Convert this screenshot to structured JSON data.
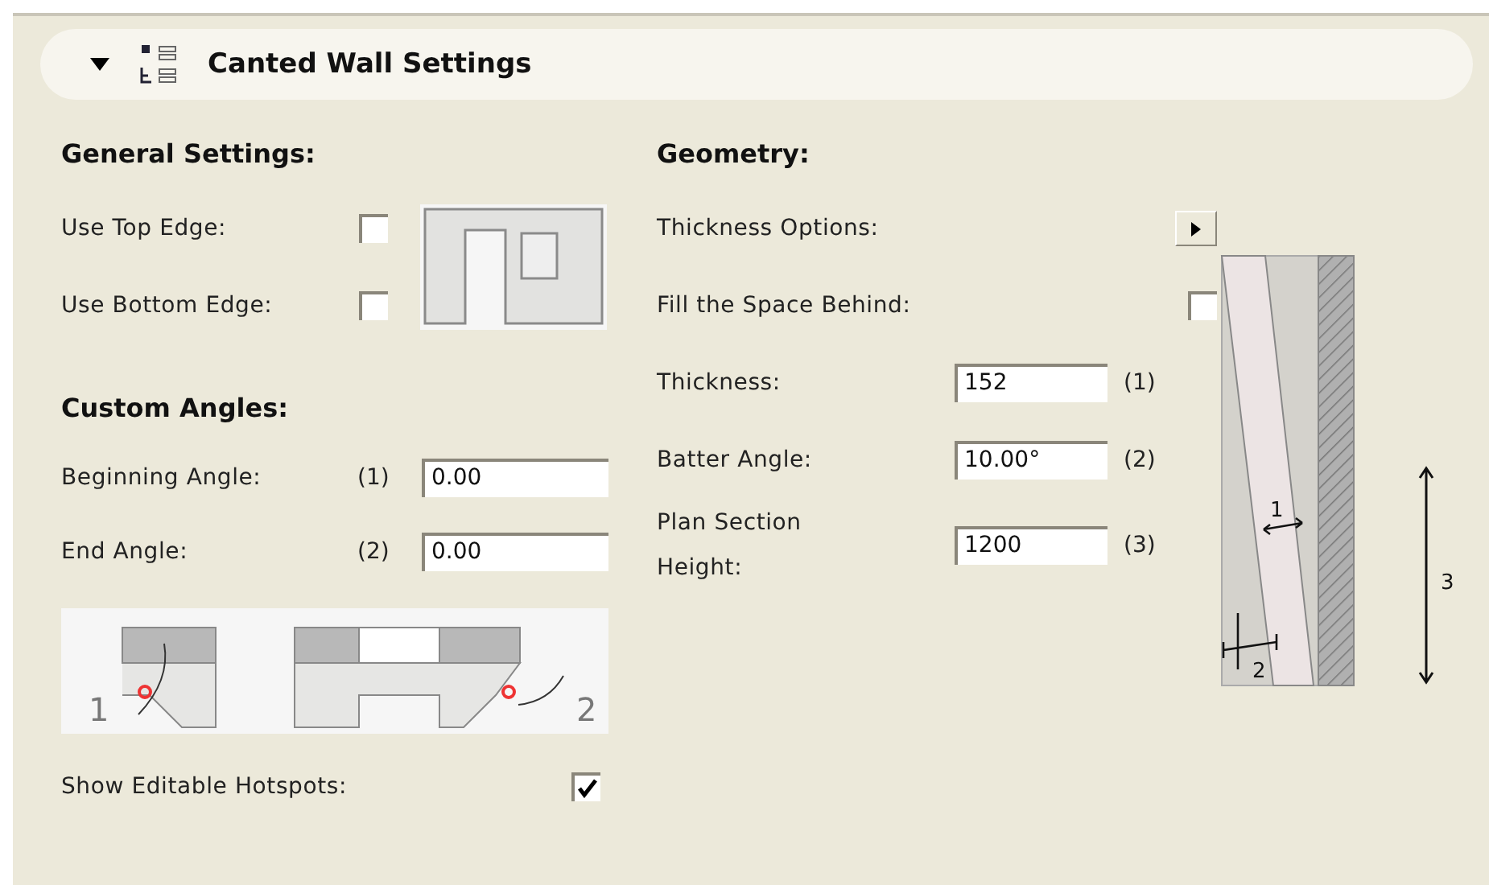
{
  "panel": {
    "title": "Canted Wall Settings",
    "expanded": true
  },
  "general": {
    "heading": "General Settings:",
    "checkboxes": [
      {
        "label": "Use Top Edge:",
        "checked": false
      },
      {
        "label": "Use Bottom Edge:",
        "checked": false
      }
    ]
  },
  "custom_angles": {
    "heading": "Custom Angles:",
    "fields": [
      {
        "label": "Beginning Angle:",
        "index": "(1)",
        "value": "0.00"
      },
      {
        "label": "End Angle:",
        "index": "(2)",
        "value": "0.00"
      }
    ],
    "diagram_labels": [
      "1",
      "2"
    ]
  },
  "hotspots": {
    "label": "Show Editable Hotspots:",
    "checked": true
  },
  "geometry": {
    "heading": "Geometry:",
    "rows": [
      {
        "kind": "menu",
        "label": "Thickness Options:"
      },
      {
        "kind": "checkbox",
        "label": "Fill the Space Behind:",
        "checked": false
      },
      {
        "kind": "field",
        "label": "Thickness:",
        "value": "152",
        "index": "(1)"
      },
      {
        "kind": "field",
        "label": "Batter Angle:",
        "value": "10.00°",
        "index": "(2)"
      },
      {
        "kind": "field",
        "label": "Plan Section Height:",
        "value": "1200",
        "index": "(3)"
      }
    ],
    "diagram_labels": [
      "1",
      "2",
      "3"
    ]
  }
}
